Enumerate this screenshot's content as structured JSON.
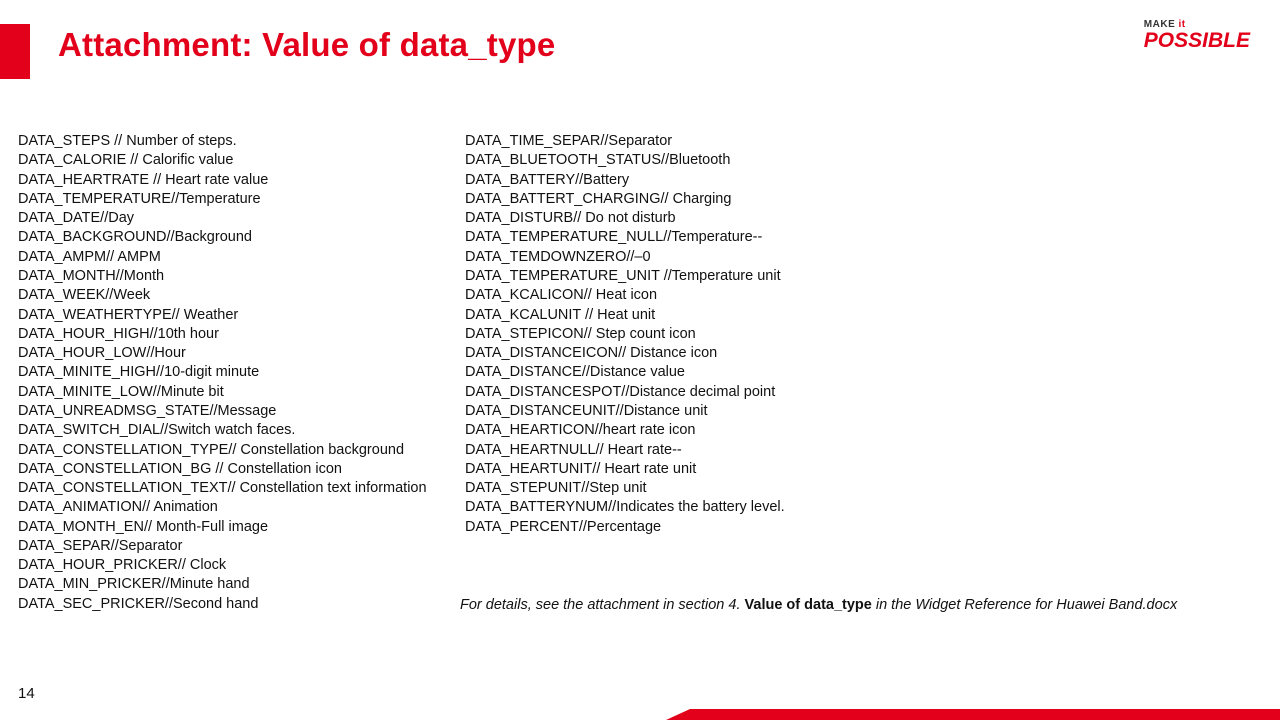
{
  "header": {
    "title": "Attachment: Value of data_type"
  },
  "logo": {
    "make": "MAKE",
    "it": "it",
    "possible": "POSSIBLE"
  },
  "columns": {
    "left": "DATA_STEPS // Number of steps.\nDATA_CALORIE // Calorific value\nDATA_HEARTRATE // Heart rate value\nDATA_TEMPERATURE//Temperature\nDATA_DATE//Day\nDATA_BACKGROUND//Background\nDATA_AMPM// AMPM\nDATA_MONTH//Month\nDATA_WEEK//Week\nDATA_WEATHERTYPE// Weather\nDATA_HOUR_HIGH//10th hour\nDATA_HOUR_LOW//Hour\nDATA_MINITE_HIGH//10-digit minute\nDATA_MINITE_LOW//Minute bit\nDATA_UNREADMSG_STATE//Message\nDATA_SWITCH_DIAL//Switch watch faces.\nDATA_CONSTELLATION_TYPE// Constellation background\nDATA_CONSTELLATION_BG // Constellation icon\nDATA_CONSTELLATION_TEXT// Constellation text information\nDATA_ANIMATION// Animation\nDATA_MONTH_EN// Month-Full image\nDATA_SEPAR//Separator\nDATA_HOUR_PRICKER// Clock\nDATA_MIN_PRICKER//Minute hand\nDATA_SEC_PRICKER//Second hand",
    "right": "DATA_TIME_SEPAR//Separator\nDATA_BLUETOOTH_STATUS//Bluetooth\nDATA_BATTERY//Battery\nDATA_BATTERT_CHARGING// Charging\nDATA_DISTURB// Do not disturb\nDATA_TEMPERATURE_NULL//Temperature--\nDATA_TEMDOWNZERO//–0\nDATA_TEMPERATURE_UNIT //Temperature unit\nDATA_KCALICON// Heat icon\nDATA_KCALUNIT // Heat unit\nDATA_STEPICON// Step count icon\nDATA_DISTANCEICON// Distance icon\nDATA_DISTANCE//Distance value\nDATA_DISTANCESPOT//Distance decimal point\nDATA_DISTANCEUNIT//Distance unit\nDATA_HEARTICON//heart rate icon\nDATA_HEARTNULL// Heart rate--\nDATA_HEARTUNIT// Heart rate unit\nDATA_STEPUNIT//Step unit\nDATA_BATTERYNUM//Indicates the battery level.\nDATA_PERCENT//Percentage"
  },
  "footnote": {
    "prefix": "For details, see the attachment in section 4. ",
    "bold1": "Value of data_type",
    "mid": " in the ",
    "italic_tail": "Widget Reference for Huawei Band.docx"
  },
  "page_number": "14"
}
